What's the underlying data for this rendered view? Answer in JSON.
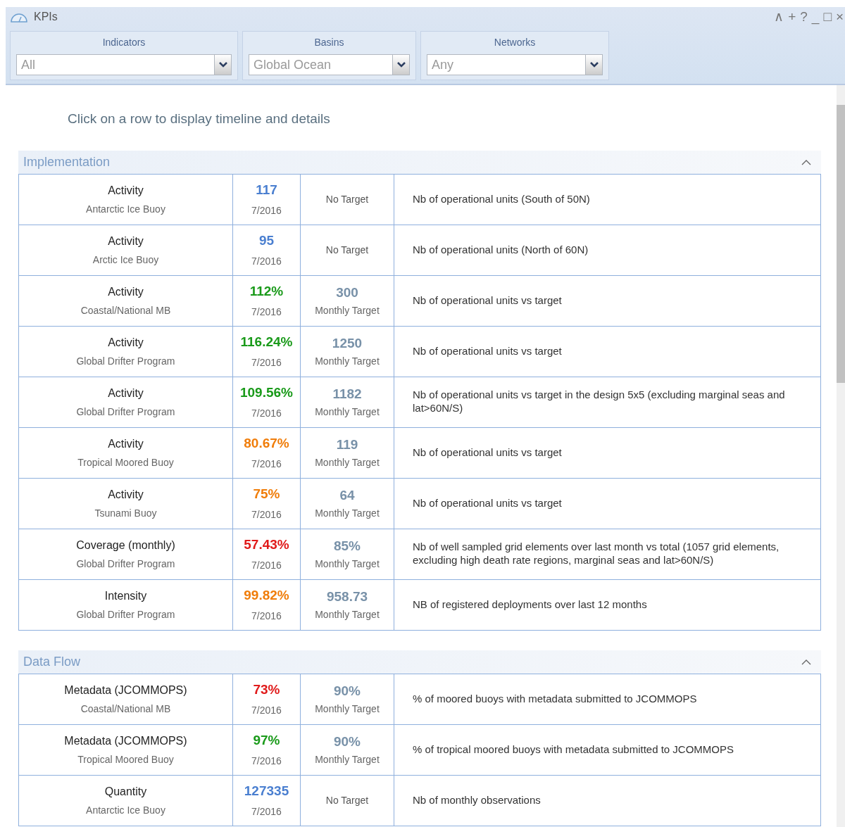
{
  "window": {
    "title": "KPIs",
    "controls": [
      "∧",
      "+",
      "?",
      "_",
      "□",
      "×"
    ]
  },
  "filters": [
    {
      "label": "Indicators",
      "value": "All"
    },
    {
      "label": "Basins",
      "value": "Global Ocean"
    },
    {
      "label": "Networks",
      "value": "Any"
    }
  ],
  "hint": "Click on a row to display timeline and details",
  "sections": [
    {
      "title": "Implementation",
      "expanded": true,
      "rows": [
        {
          "indicator": "Activity",
          "network": "Antarctic Ice Buoy",
          "value": "117",
          "color": "#4a7fd0",
          "date": "7/2016",
          "target": "No Target",
          "description": "Nb of operational units (South of 50N)"
        },
        {
          "indicator": "Activity",
          "network": "Arctic Ice Buoy",
          "value": "95",
          "color": "#4a7fd0",
          "date": "7/2016",
          "target": "No Target",
          "description": "Nb of operational units (North of 60N)"
        },
        {
          "indicator": "Activity",
          "network": "Coastal/National MB",
          "value": "112%",
          "color": "#1a9a1a",
          "date": "7/2016",
          "target_value": "300",
          "target": "Monthly Target",
          "description": "Nb of operational units vs target"
        },
        {
          "indicator": "Activity",
          "network": "Global Drifter Program",
          "value": "116.24%",
          "color": "#1a9a1a",
          "date": "7/2016",
          "target_value": "1250",
          "target": "Monthly Target",
          "description": "Nb of operational units vs target"
        },
        {
          "indicator": "Activity",
          "network": "Global Drifter Program",
          "value": "109.56%",
          "color": "#1a9a1a",
          "date": "7/2016",
          "target_value": "1182",
          "target": "Monthly Target",
          "description": "Nb of operational units vs target in the design 5x5 (excluding marginal seas and lat>60N/S)"
        },
        {
          "indicator": "Activity",
          "network": "Tropical Moored Buoy",
          "value": "80.67%",
          "color": "#f07d0a",
          "date": "7/2016",
          "target_value": "119",
          "target": "Monthly Target",
          "description": "Nb of operational units vs target"
        },
        {
          "indicator": "Activity",
          "network": "Tsunami Buoy",
          "value": "75%",
          "color": "#f07d0a",
          "date": "7/2016",
          "target_value": "64",
          "target": "Monthly Target",
          "description": "Nb of operational units vs target"
        },
        {
          "indicator": "Coverage (monthly)",
          "network": "Global Drifter Program",
          "value": "57.43%",
          "color": "#e01a1a",
          "date": "7/2016",
          "target_value": "85%",
          "target": "Monthly Target",
          "description": "Nb of well sampled grid elements over last month vs total (1057 grid elements, excluding high death rate regions, marginal seas and lat>60N/S)"
        },
        {
          "indicator": "Intensity",
          "network": "Global Drifter Program",
          "value": "99.82%",
          "color": "#f07d0a",
          "date": "7/2016",
          "target_value": "958.73",
          "target": "Monthly Target",
          "description": "NB of registered deployments over last 12 months"
        }
      ]
    },
    {
      "title": "Data Flow",
      "expanded": true,
      "rows": [
        {
          "indicator": "Metadata (JCOMMOPS)",
          "network": "Coastal/National MB",
          "value": "73%",
          "color": "#e01a1a",
          "date": "7/2016",
          "target_value": "90%",
          "target": "Monthly Target",
          "description": "% of moored buoys with metadata submitted to JCOMMOPS"
        },
        {
          "indicator": "Metadata (JCOMMOPS)",
          "network": "Tropical Moored Buoy",
          "value": "97%",
          "color": "#1a9a1a",
          "date": "7/2016",
          "target_value": "90%",
          "target": "Monthly Target",
          "description": "% of tropical moored buoys with metadata submitted to JCOMMOPS"
        },
        {
          "indicator": "Quantity",
          "network": "Antarctic Ice Buoy",
          "value": "127335",
          "color": "#4a7fd0",
          "date": "7/2016",
          "target": "No Target",
          "description": "Nb of monthly observations"
        }
      ]
    }
  ]
}
